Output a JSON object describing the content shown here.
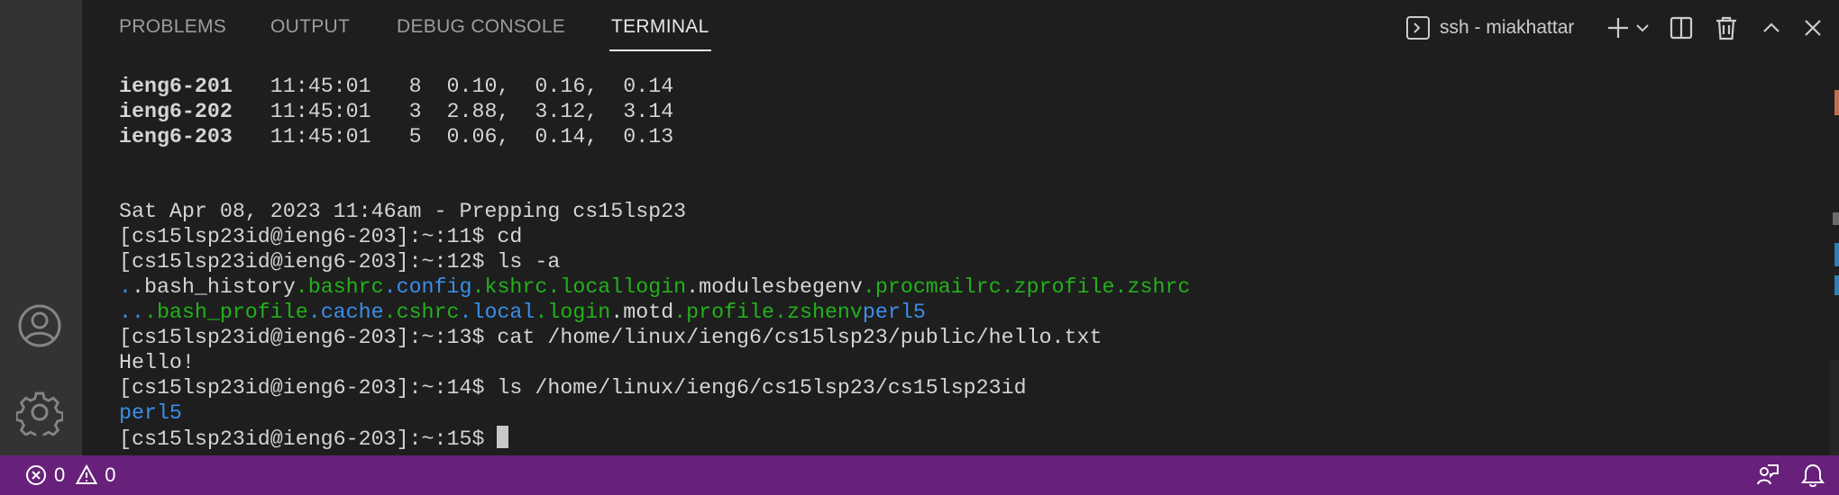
{
  "panel": {
    "tabs": [
      {
        "label": "PROBLEMS",
        "active": false
      },
      {
        "label": "OUTPUT",
        "active": false
      },
      {
        "label": "DEBUG CONSOLE",
        "active": false
      },
      {
        "label": "TERMINAL",
        "active": true
      }
    ],
    "terminal_name": "ssh - miakhattar",
    "icons": [
      "terminal-icon",
      "plus-icon",
      "chevron-down-icon",
      "split-icon",
      "trash-icon",
      "chevron-up-icon",
      "close-icon"
    ]
  },
  "activity_bar": {
    "icons": [
      "account-icon",
      "gear-icon"
    ]
  },
  "terminal": {
    "load_rows": [
      {
        "host": "ieng6-201",
        "time": "11:45:01",
        "users": "8",
        "l1": "0.10,",
        "l5": "0.16,",
        "l15": "0.14"
      },
      {
        "host": "ieng6-202",
        "time": "11:45:01",
        "users": "3",
        "l1": "2.88,",
        "l5": "3.12,",
        "l15": "3.14"
      },
      {
        "host": "ieng6-203",
        "time": "11:45:01",
        "users": "5",
        "l1": "0.06,",
        "l5": "0.14,",
        "l15": "0.13"
      }
    ],
    "banner": "Sat Apr 08, 2023 11:46am - Prepping cs15lsp23",
    "commands": {
      "c11": "[cs15lsp23id@ieng6-203]:~:11$ cd",
      "c12": "[cs15lsp23id@ieng6-203]:~:12$ ls -a",
      "c13": "[cs15lsp23id@ieng6-203]:~:13$ cat /home/linux/ieng6/cs15lsp23/public/hello.txt",
      "c14": "[cs15lsp23id@ieng6-203]:~:14$ ls /home/linux/ieng6/cs15lsp23/cs15lsp23id",
      "c15": "[cs15lsp23id@ieng6-203]:~:15$ "
    },
    "ls_row1": [
      {
        "name": ".",
        "color": "blue"
      },
      {
        "name": ".bash_history",
        "color": "white"
      },
      {
        "name": ".bashrc",
        "color": "green"
      },
      {
        "name": ".config",
        "color": "blue"
      },
      {
        "name": ".kshrc",
        "color": "green"
      },
      {
        "name": ".locallogin",
        "color": "green"
      },
      {
        "name": ".modulesbegenv",
        "color": "white"
      },
      {
        "name": ".procmailrc",
        "color": "green"
      },
      {
        "name": ".zprofile",
        "color": "green"
      },
      {
        "name": ".zshrc",
        "color": "green"
      }
    ],
    "ls_row2": [
      {
        "name": "..",
        "color": "blue"
      },
      {
        "name": ".bash_profile",
        "color": "green"
      },
      {
        "name": ".cache",
        "color": "blue"
      },
      {
        "name": ".cshrc",
        "color": "green"
      },
      {
        "name": ".local",
        "color": "blue"
      },
      {
        "name": ".login",
        "color": "green"
      },
      {
        "name": ".motd",
        "color": "white"
      },
      {
        "name": ".profile",
        "color": "green"
      },
      {
        "name": ".zshenv",
        "color": "green"
      },
      {
        "name": "perl5",
        "color": "blue"
      }
    ],
    "hello_output": "Hello!",
    "ls_output": "perl5"
  },
  "status_bar": {
    "errors": "0",
    "warnings": "0",
    "background": "#68217a",
    "icons": [
      "error-icon",
      "warning-icon",
      "feedback-icon",
      "bell-icon"
    ]
  },
  "colors": {
    "green": "#23b11b",
    "blue": "#3b8eea",
    "text": "#d4d4d4"
  }
}
